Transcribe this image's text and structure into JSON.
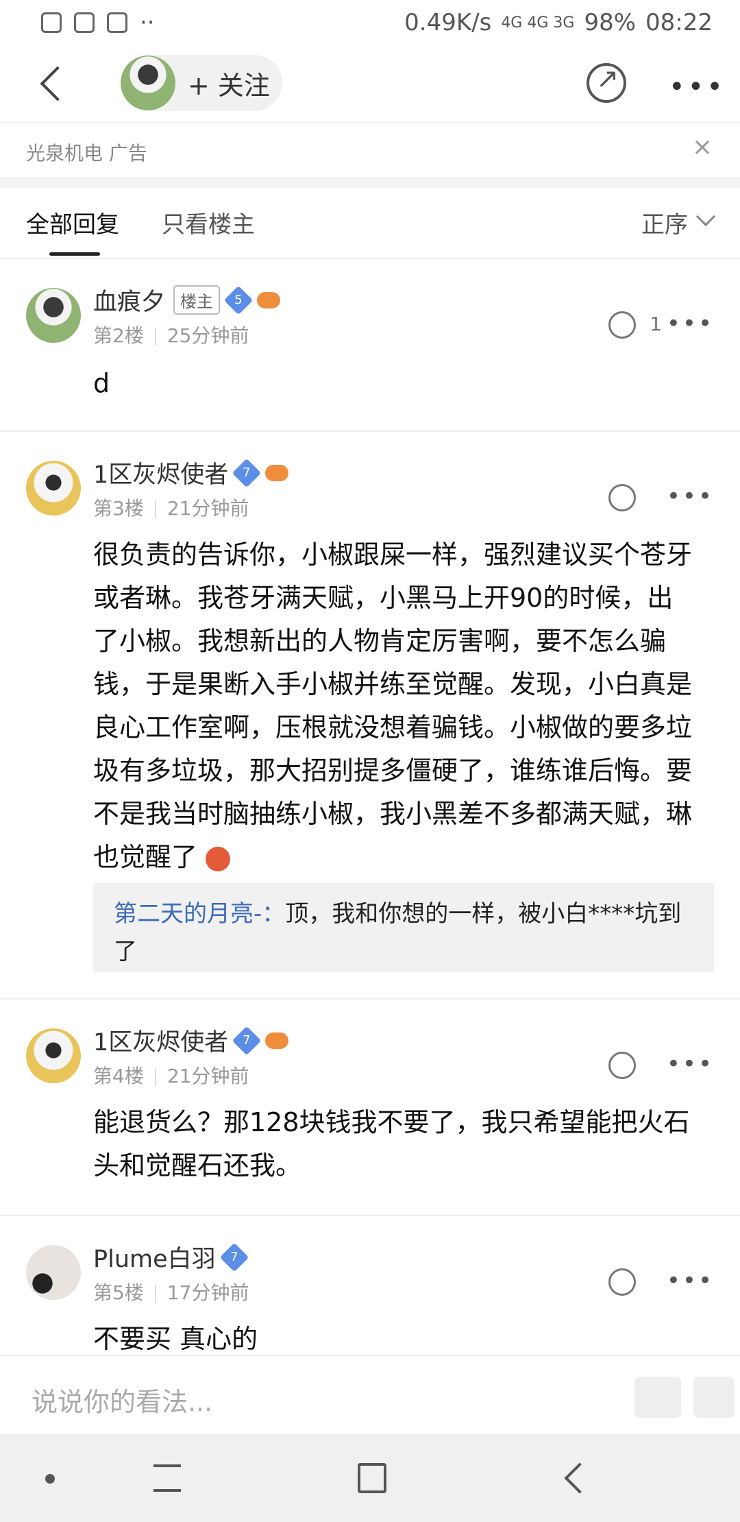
{
  "status_bar": {
    "speed": "0.49K/s",
    "network": "4G 4G 3G",
    "battery": "98%",
    "time": "08:22"
  },
  "header": {
    "follow_label": "+ 关注",
    "share_icon": "share-icon",
    "more_icon": "more-icon"
  },
  "ad": {
    "text": "光泉机电  广告",
    "close": "×"
  },
  "tabs": {
    "all": "全部回复",
    "op_only": "只看楼主",
    "sort": "正序"
  },
  "posts": [
    {
      "user": "血痕夕",
      "tag": "楼主",
      "level": "5",
      "floor": "第2楼",
      "time": "25分钟前",
      "likes": "1",
      "content": "d"
    },
    {
      "user": "1区灰烬使者",
      "level": "7",
      "floor": "第3楼",
      "time": "21分钟前",
      "content": "很负责的告诉你，小椒跟屎一样，强烈建议买个苍牙或者琳。我苍牙满天赋，小黑马上开90的时候，出了小椒。我想新出的人物肯定厉害啊，要不怎么骗钱，于是果断入手小椒并练至觉醒。发现，小白真是良心工作室啊，压根就没想着骗钱。小椒做的要多垃圾有多垃圾，那大招别提多僵硬了，谁练谁后悔。要不是我当时脑抽练小椒，我小黑差不多都满天赋，琳也觉醒了",
      "reply": {
        "name": "第二天的月亮-：",
        "text": "顶，我和你想的一样，被小白****坑到了"
      }
    },
    {
      "user": "1区灰烬使者",
      "level": "7",
      "floor": "第4楼",
      "time": "21分钟前",
      "content": "能退货么？那128块钱我不要了，我只希望能把火石头和觉醒石还我。"
    },
    {
      "user": "Plume白羽",
      "level": "7",
      "floor": "第5楼",
      "time": "17分钟前",
      "content": "不要买 真心的"
    }
  ],
  "input": {
    "placeholder": "说说你的看法..."
  }
}
